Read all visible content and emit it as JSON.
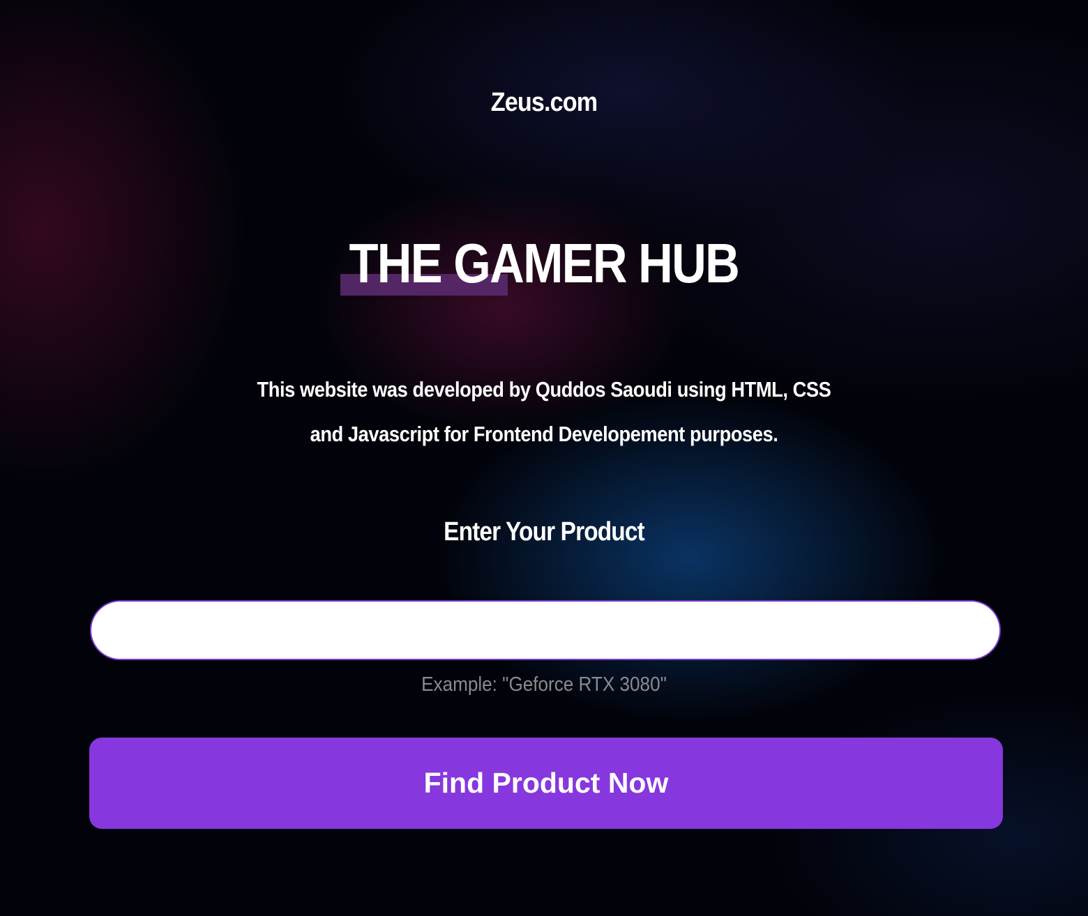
{
  "header": {
    "site_name": "Zeus.com"
  },
  "hero": {
    "title": "THE GAMER HUB",
    "description": "This website was developed by Quddos Saoudi using HTML, CSS and Javascript for Frontend Developement purposes."
  },
  "search": {
    "label": "Enter Your Product",
    "value": "",
    "hint": "Example: \"Geforce RTX 3080\"",
    "button_label": "Find Product Now"
  },
  "colors": {
    "accent": "#8637de",
    "input_border": "#7a3ad0",
    "title_underline": "#5a2a6e",
    "hint_text": "#8a8a92",
    "background": "#02030a"
  }
}
